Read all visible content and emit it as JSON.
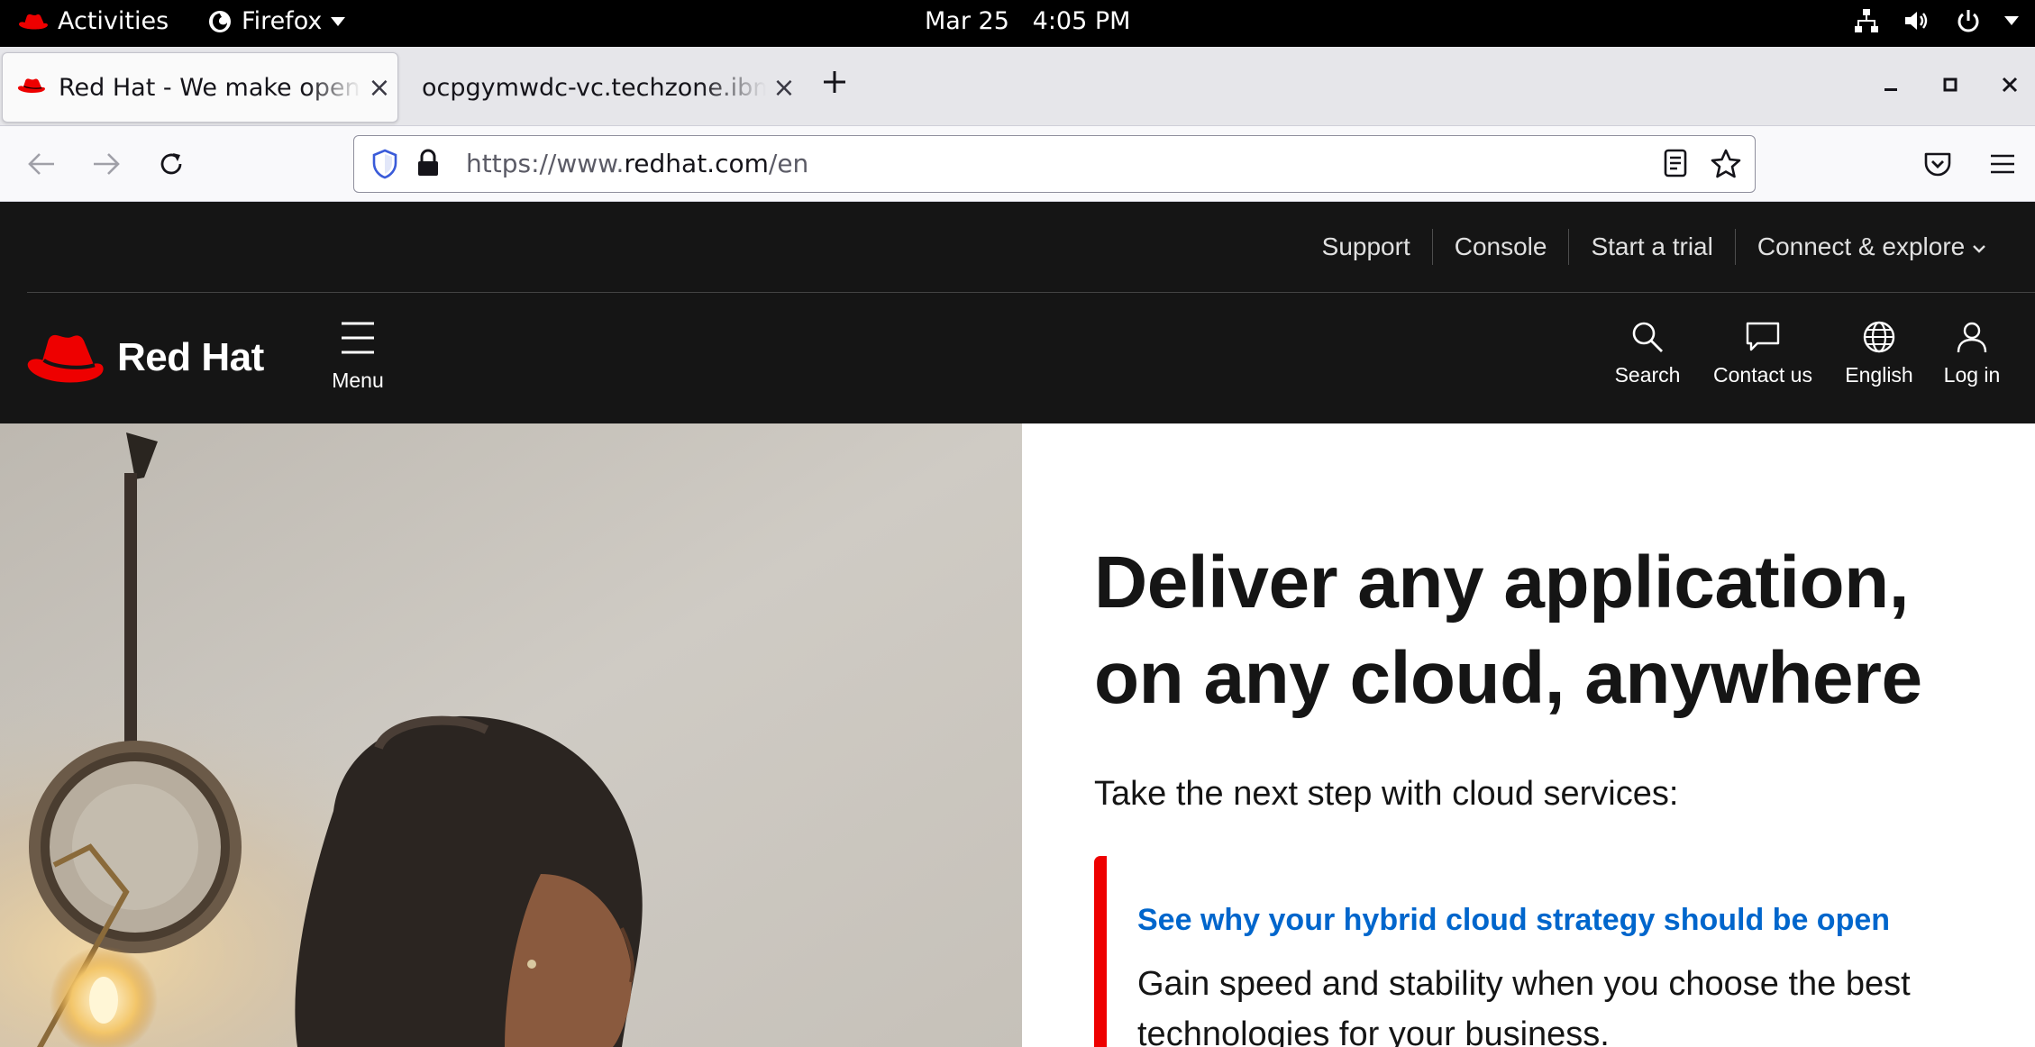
{
  "gnome": {
    "activities": "Activities",
    "app_name": "Firefox",
    "date": "Mar 25",
    "time": "4:05 PM"
  },
  "browser": {
    "tabs": [
      {
        "title": "Red Hat - We make open source technologies for the enterprise",
        "active": true
      },
      {
        "title": "ocpgymwdc-vc.techzone.ibm.com",
        "active": false
      }
    ],
    "url_prefix": "https://www.",
    "url_host": "redhat.com",
    "url_path": "/en"
  },
  "page": {
    "utility_links": [
      "Support",
      "Console",
      "Start a trial",
      "Connect & explore"
    ],
    "logo_text": "Red Hat",
    "menu_label": "Menu",
    "nav": {
      "search": "Search",
      "contact": "Contact us",
      "language": "English",
      "login": "Log in"
    },
    "hero": {
      "headline": "Deliver any application, on any cloud, anywhere",
      "subhead": "Take the next step with cloud services:",
      "card_link": "See why your hybrid cloud strategy should be open",
      "card_body": "Gain speed and stability when you choose the best technologies for your business."
    },
    "colors": {
      "brand_red": "#ee0000",
      "link_blue": "#0066cc",
      "dark_bg": "#151515"
    }
  }
}
